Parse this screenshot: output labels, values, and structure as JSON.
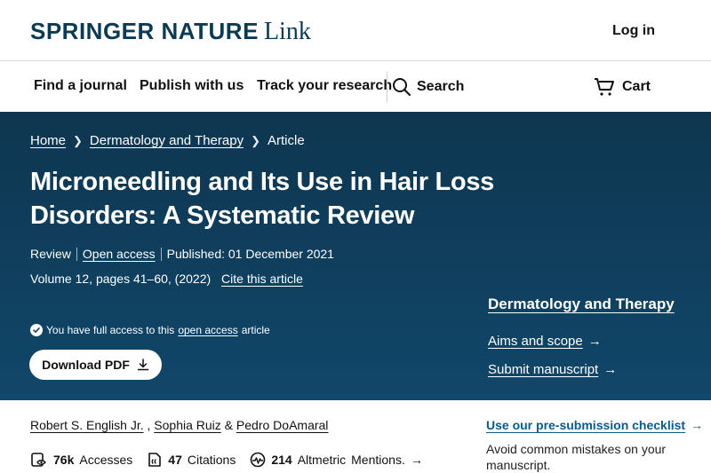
{
  "header": {
    "brand": "SPRINGER NATURE",
    "brand_suffix": "Link",
    "login": "Log in"
  },
  "nav": {
    "items": [
      {
        "label": "Find a journal"
      },
      {
        "label": "Publish with us"
      },
      {
        "label": "Track your research"
      }
    ],
    "search_label": "Search",
    "cart_label": "Cart"
  },
  "breadcrumb": {
    "home": "Home",
    "journal": "Dermatology and Therapy",
    "current": "Article"
  },
  "article": {
    "title": "Microneedling and Its Use in Hair Loss Disorders: A Systematic Review",
    "type": "Review",
    "open_access": "Open access",
    "published": "Published: 01 December 2021",
    "volume": "Volume 12, pages 41–60, (2022)",
    "cite": "Cite this article",
    "access_prefix": "You have full access to this",
    "access_link": "open access",
    "access_suffix": "article",
    "download": "Download PDF"
  },
  "journal_panel": {
    "name": "Dermatology and Therapy",
    "links": [
      {
        "label": "Aims and scope"
      },
      {
        "label": "Submit manuscript"
      }
    ]
  },
  "authors": {
    "a1": "Robert S. English Jr.",
    "sep1": " , ",
    "a2": "Sophia Ruiz",
    "sep2": " & ",
    "a3": "Pedro DoAmaral"
  },
  "metrics": {
    "accesses_value": "76k",
    "accesses_label": "Accesses",
    "citations_value": "47",
    "citations_label": "Citations",
    "altmetric_value": "214",
    "altmetric_label": "Altmetric",
    "mentions_label": "Mentions",
    "mentions_suffix": "."
  },
  "checklist": {
    "title": "Use our pre-submission checklist",
    "description": "Avoid common mistakes on your manuscript."
  },
  "colors": {
    "hero_dark": "#0e3650",
    "hero_light": "#11476a",
    "brand": "#0b3a55",
    "link_blue": "#0b5a8a"
  },
  "icons": [
    "search-icon",
    "cart-icon",
    "chevron-right-icon",
    "check-circle-icon",
    "download-icon",
    "arrow-right-icon",
    "accesses-icon",
    "citations-icon",
    "altmetric-icon"
  ]
}
